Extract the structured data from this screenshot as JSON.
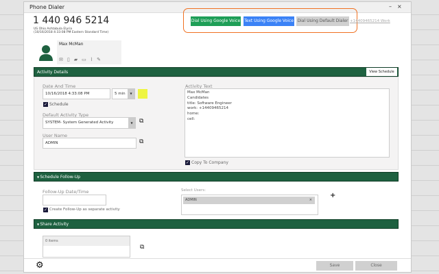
{
  "window": {
    "title": "Phone Dialer",
    "minimize": "–",
    "close": "×"
  },
  "phone": {
    "number": "1 440 946 5214",
    "location": "US Ohio Ashtabula Elyria",
    "time": "(10/16/2018 4:33:08 PM Eastern Standard Time)"
  },
  "contact": {
    "name": "Max McMan",
    "icons": [
      "email-icon",
      "contact-card-icon",
      "chat-icon",
      "document-icon",
      "attachment-icon",
      "edit-note-icon"
    ]
  },
  "actions": {
    "dial_google": "Dial Using Google Voice",
    "text_google": "Text Using Google Voice",
    "dial_default": "Dial Using Default Dialer",
    "work_link": "+14409465214 Work",
    "colors": {
      "green": "#1e9e57",
      "blue": "#3b82f6",
      "grey": "#d0d0d0",
      "highlight": "#f07020"
    }
  },
  "activity": {
    "header": "Activity Details",
    "view_schedule": "View Schedule",
    "date_label": "Date And Time",
    "date_value": "10/16/2018 4:33:08 PM",
    "duration": "5 min",
    "color_swatch": "#eef542",
    "schedule_label": "Schedule",
    "type_label": "Default Activity Type",
    "type_value": "SYSTEM- System Generated Activity",
    "user_label": "User Name",
    "user_value": "ADMIN",
    "text_label": "Activity Text",
    "text_lines": [
      "Max McMan",
      "Candidates",
      "title: Software Engineer",
      "work: +14409465214",
      "home:",
      "cell:"
    ],
    "copy_label": "Copy To Company"
  },
  "followup": {
    "header": "Schedule Follow-Up",
    "date_label": "Follow-Up Date/Time",
    "date_value": "",
    "separate_label": "Create Follow-Up as separate activity",
    "users_label": "Select Users:",
    "user_chip": "ADMIN",
    "chip_remove": "×",
    "add": "+"
  },
  "share": {
    "header": "Share Activity",
    "items": "0 items"
  },
  "footer": {
    "save": "Save",
    "close": "Close"
  }
}
